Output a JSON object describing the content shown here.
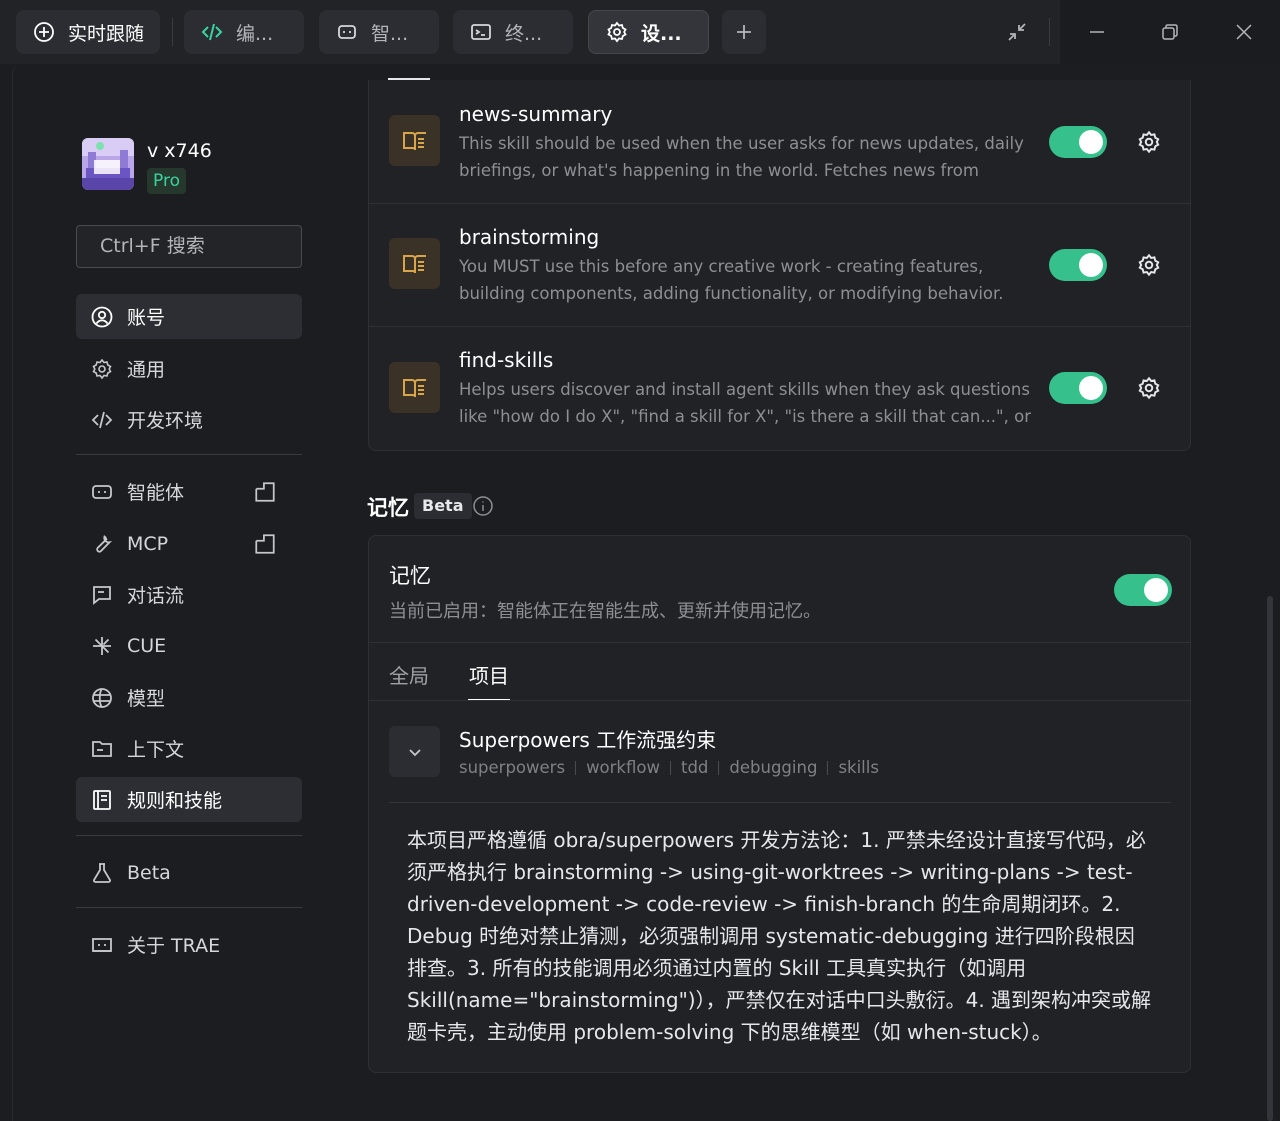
{
  "tabs": [
    {
      "label": "实时跟随",
      "icon": "plus-circle-icon"
    },
    {
      "label": "编...",
      "icon": "code-icon"
    },
    {
      "label": "智...",
      "icon": "agent-icon"
    },
    {
      "label": "终...",
      "icon": "terminal-icon"
    },
    {
      "label": "设...",
      "icon": "gear-icon"
    }
  ],
  "user": {
    "name": "v x746",
    "plan": "Pro"
  },
  "search": {
    "placeholder": "Ctrl+F 搜索"
  },
  "nav": {
    "account": "账号",
    "general": "通用",
    "dev_env": "开发环境",
    "agents": "智能体",
    "mcp": "MCP",
    "chat_flow": "对话流",
    "cue": "CUE",
    "models": "模型",
    "context": "上下文",
    "rules_skills": "规则和技能",
    "beta": "Beta",
    "about": "关于 TRAE"
  },
  "skills": [
    {
      "name": "news-summary",
      "desc": "This skill should be used when the user asks for news updates, daily briefings, or what's happening in the world. Fetches news from trusted inter...",
      "enabled": true
    },
    {
      "name": "brainstorming",
      "desc": "You MUST use this before any creative work - creating features, building components, adding functionality, or modifying behavior. Explores user...",
      "enabled": true
    },
    {
      "name": "find-skills",
      "desc": "Helps users discover and install agent skills when they ask questions like \"how do I do X\", \"find a skill for X\", \"is there a skill that can...\", or expres...",
      "enabled": true
    }
  ],
  "memory": {
    "section_title": "记忆",
    "badge": "Beta",
    "title": "记忆",
    "status": "当前已启用：智能体正在智能生成、更新并使用记忆。",
    "enabled": true,
    "tabs": [
      "全局",
      "项目"
    ],
    "active_tab": "项目",
    "rule": {
      "title": "Superpowers 工作流强约束",
      "tags": [
        "superpowers",
        "workflow",
        "tdd",
        "debugging",
        "skills"
      ],
      "body": "本项目严格遵循 obra/superpowers 开发方法论：1. 严禁未经设计直接写代码，必须严格执行 brainstorming -> using-git-worktrees -> writing-plans -> test-driven-development -> code-review -> finish-branch 的生命周期闭环。2. Debug 时绝对禁止猜测，必须强制调用 systematic-debugging 进行四阶段根因排查。3. 所有的技能调用必须通过内置的 Skill 工具真实执行（如调用 Skill(name=\"brainstorming\")），严禁仅在对话中口头敷衍。4. 遇到架构冲突或解题卡壳，主动使用 problem-solving 下的思维模型（如 when-stuck）。"
    }
  },
  "colors": {
    "accent_green": "#35c08c",
    "pro_green": "#38d39f",
    "skill_icon_bg": "#3a3226",
    "skill_icon_fg": "#d9a54a"
  }
}
